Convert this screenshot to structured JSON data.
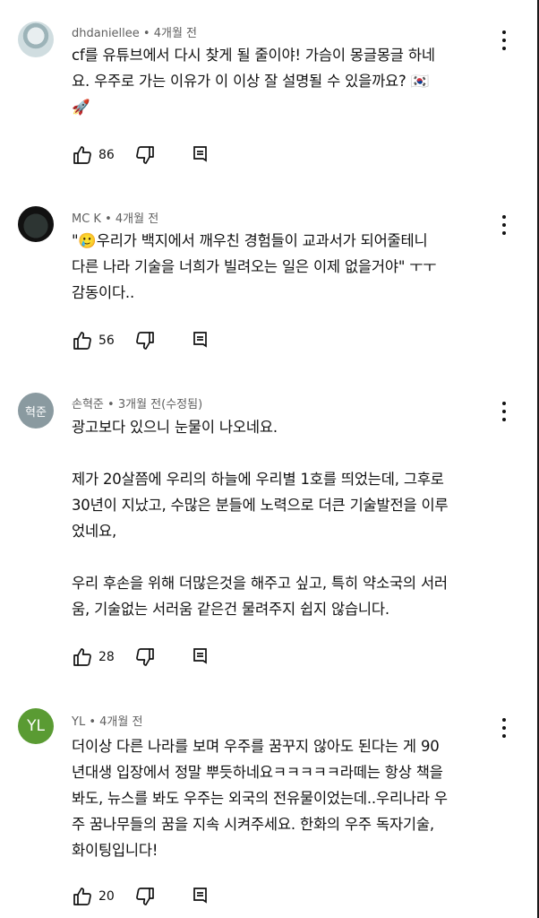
{
  "comments": [
    {
      "author": "dhdaniellee",
      "time": "4개월 전",
      "text": "cf를 유튜브에서 다시 찾게 될 줄이야! 가슴이 몽글몽글 하네\n요. 우주로 가는 이유가 이 이상 잘 설명될 수 있을까요? 🇰🇷\n🚀",
      "likes": "86"
    },
    {
      "author": "MC K",
      "time": "4개월 전",
      "text": "\"🥲우리가 백지에서 깨우친 경험들이 교과서가 되어줄테니\n다른 나라 기술을 너희가 빌려오는 일은 이제 없을거야\" ㅜㅜ\n감동이다..",
      "likes": "56"
    },
    {
      "author": "손혁준",
      "time": "3개월 전(수정됨)",
      "avatar_text": "혁준",
      "text": "광고보다 있으니 눈물이 나오네요.\n\n제가 20살쯤에 우리의 하늘에 우리별 1호를 띄었는데, 그후로\n30년이 지났고, 수많은 분들에 노력으로 더큰 기술발전을 이루\n었네요,\n\n우리 후손을 위해 더많은것을 해주고 싶고, 특히 약소국의 서러\n움, 기술없는 서러움 같은건 물려주지 쉽지 않습니다.",
      "likes": "28"
    },
    {
      "author": "YL",
      "time": "4개월 전",
      "avatar_text": "YL",
      "text": "더이상 다른 나라를 보며 우주를 꿈꾸지 않아도 된다는 게 90\n년대생 입장에서 정말 뿌듯하네요ㅋㅋㅋㅋㅋ라떼는 항상 책을\n봐도, 뉴스를 봐도 우주는 외국의 전유물이었는데..우리나라 우\n주 꿈나무들의 꿈을 지속 시켜주세요. 한화의 우주 독자기술,\n화이팅입니다!",
      "likes": "20"
    }
  ],
  "meta_separator": "•",
  "icons": {
    "like": "thumb-up-icon",
    "dislike": "thumb-down-icon",
    "reply": "reply-icon",
    "more": "more-vert-icon"
  }
}
